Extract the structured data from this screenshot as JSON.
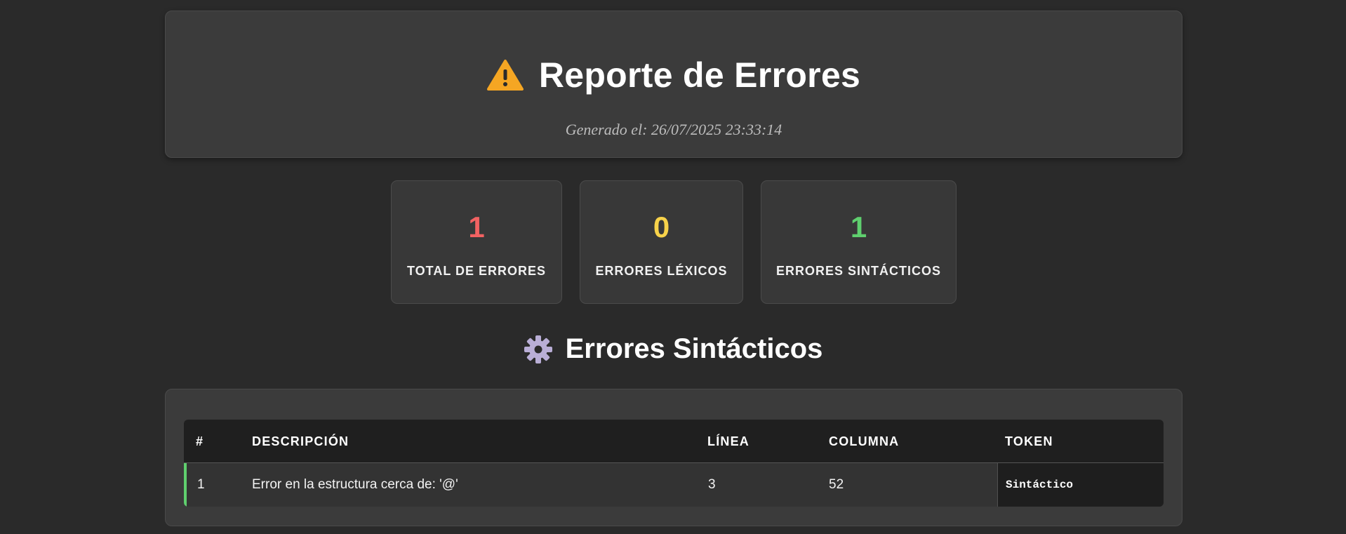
{
  "header": {
    "title": "Reporte de Errores",
    "icon": "warning-icon",
    "generated": "Generado el: 26/07/2025 23:33:14"
  },
  "stats": [
    {
      "value": "1",
      "label": "TOTAL DE ERRORES",
      "color": "#f26262"
    },
    {
      "value": "0",
      "label": "ERRORES LÉXICOS",
      "color": "#f7d24a"
    },
    {
      "value": "1",
      "label": "ERRORES SINTÁCTICOS",
      "color": "#5fcf6e"
    }
  ],
  "section": {
    "title": "Errores Sintácticos",
    "icon": "gear-icon"
  },
  "table": {
    "headers": [
      "#",
      "DESCRIPCIÓN",
      "LÍNEA",
      "COLUMNA",
      "TOKEN"
    ],
    "rows": [
      {
        "num": "1",
        "description": "Error en la estructura cerca de: '@'",
        "line": "3",
        "column": "52",
        "token": "Sintáctico"
      }
    ]
  },
  "colors": {
    "background": "#2a2a2a",
    "card": "#3b3b3b",
    "accent_row": "#5fcf6e"
  }
}
